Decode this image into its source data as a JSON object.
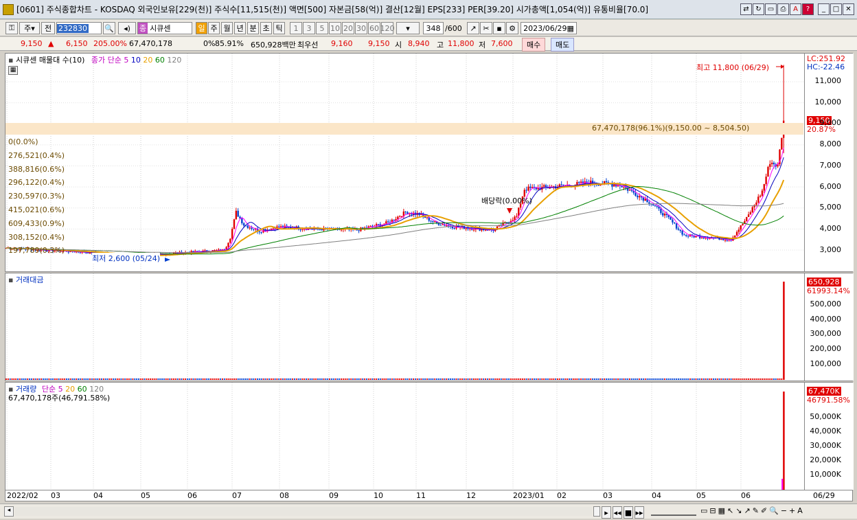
{
  "window": {
    "title": "[0601] 주식종합차트 - KOSDAQ 외국인보유[229(천)] 주식수[11,515(천)] 액면[500] 자본금[58(억)] 결산[12월] EPS[233] PER[39.20] 시가총액[1,054(억)] 유통비율[70.0]"
  },
  "toolbar": {
    "type": "주",
    "prev": "전",
    "code": "232830",
    "name": "시큐센",
    "period_sel": "일",
    "periods": [
      "주",
      "월",
      "년",
      "분",
      "초",
      "틱"
    ],
    "nums": [
      "1",
      "3",
      "5",
      "10",
      "20",
      "30",
      "60",
      "120"
    ],
    "count": "348",
    "count_total": "/600",
    "date": "2023/06/29"
  },
  "quote": {
    "price": "9,150",
    "arrow": "▲",
    "change": "6,150",
    "pct": "205.00%",
    "volume": "67,470,178",
    "pct_label": "0%",
    "ratio": "85.91%",
    "amount": "650,928백만",
    "bid_label": "최우선",
    "bid1": "9,160",
    "bid2": "9,150",
    "open_label": "시",
    "open": "8,940",
    "high_label": "고",
    "high": "11,800",
    "low_label": "저",
    "low": "7,600",
    "buy": "매수",
    "sell": "매도"
  },
  "price_panel": {
    "legend_name": "시큐센 매물대 수(10)",
    "legend_ma": "종가 단순 5",
    "ma_periods": [
      "10",
      "20",
      "60",
      "120"
    ],
    "lc": "LC:251.92",
    "hc": "HC:-22.46",
    "max_label": "최고 11,800 (06/29)",
    "min_label": "최저 2,600 (05/24)",
    "dividend_label": "배당락(0.00%)",
    "vp_highlight": "67,470,178(96.1%)(9,150.00 ~ 8,504.50)",
    "price_badge": "9,150",
    "pct_badge": "20.87%",
    "vp_rows": [
      "0(0.0%)",
      "276,521(0.4%)",
      "388,816(0.6%)",
      "296,122(0.4%)",
      "230,597(0.3%)",
      "415,021(0.6%)",
      "609,433(0.9%)",
      "308,152(0.4%)",
      "197,789(0.3%)"
    ],
    "yticks": [
      "11,000",
      "10,000",
      "9,000",
      "8,000",
      "7,000",
      "6,000",
      "5,000",
      "4,000",
      "3,000"
    ]
  },
  "amount_panel": {
    "legend": "거래대금",
    "badge": "650,928",
    "sub": "61993.14%",
    "yticks": [
      "500,000",
      "400,000",
      "300,000",
      "200,000",
      "100,000"
    ]
  },
  "volume_panel": {
    "legend": "거래량",
    "legend_ma": "단순 5",
    "ma_periods": [
      "20",
      "60",
      "120"
    ],
    "total": "67,470,178주(46,791.58%)",
    "badge": "67,470K",
    "sub": "46791.58%",
    "yticks": [
      "50,000K",
      "40,000K",
      "30,000K",
      "20,000K",
      "10,000K"
    ]
  },
  "xaxis": {
    "labels": [
      "2022/02",
      "03",
      "04",
      "05",
      "06",
      "07",
      "08",
      "09",
      "10",
      "11",
      "12",
      "2023/01",
      "02",
      "03",
      "04",
      "05",
      "06"
    ],
    "right": "06/29"
  },
  "colors": {
    "up": "#e00000",
    "down": "#0040d0",
    "ma5": "#ff00ff",
    "ma10": "#0000c0",
    "ma20": "#e8a000",
    "ma60": "#008000",
    "ma120": "#808080"
  },
  "chart_data": {
    "type": "candlestick",
    "close_path": [
      [
        0,
        3.1
      ],
      [
        20,
        3.0
      ],
      [
        40,
        2.9
      ],
      [
        60,
        2.75
      ],
      [
        68,
        2.7
      ],
      [
        80,
        2.8
      ],
      [
        95,
        2.9
      ],
      [
        112,
        3.0
      ],
      [
        115,
        3.6
      ],
      [
        118,
        4.8
      ],
      [
        122,
        4.2
      ],
      [
        130,
        3.9
      ],
      [
        140,
        4.1
      ],
      [
        160,
        4.0
      ],
      [
        180,
        3.95
      ],
      [
        196,
        4.3
      ],
      [
        205,
        4.8
      ],
      [
        212,
        4.7
      ],
      [
        220,
        4.3
      ],
      [
        230,
        4.1
      ],
      [
        250,
        3.95
      ],
      [
        262,
        4.6
      ],
      [
        266,
        5.9
      ],
      [
        280,
        6.0
      ],
      [
        300,
        6.2
      ],
      [
        315,
        6.1
      ],
      [
        330,
        5.3
      ],
      [
        340,
        4.5
      ],
      [
        348,
        3.7
      ],
      [
        360,
        3.6
      ],
      [
        372,
        3.5
      ],
      [
        380,
        4.5
      ],
      [
        388,
        5.8
      ],
      [
        392,
        7.2
      ],
      [
        396,
        7.0
      ],
      [
        399,
        9.15
      ]
    ]
  }
}
